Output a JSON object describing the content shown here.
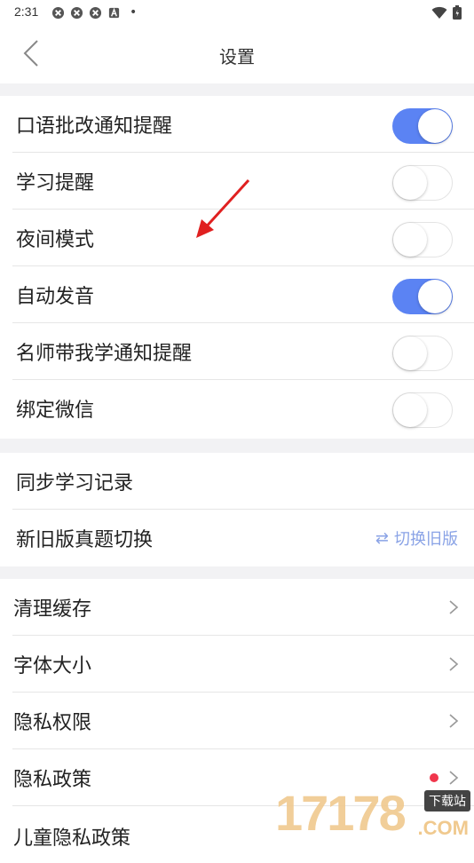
{
  "status_bar": {
    "time": "2:31",
    "dot": "•",
    "icons": [
      "app-icon",
      "app-icon",
      "app-icon",
      "a-icon"
    ],
    "right_icons": [
      "wifi-icon",
      "battery-icon"
    ]
  },
  "header": {
    "title": "设置"
  },
  "toggles": [
    {
      "label": "口语批改通知提醒",
      "on": true
    },
    {
      "label": "学习提醒",
      "on": false
    },
    {
      "label": "夜间模式",
      "on": false
    },
    {
      "label": "自动发音",
      "on": true
    },
    {
      "label": "名师带我学通知提醒",
      "on": false
    },
    {
      "label": "绑定微信",
      "on": false
    }
  ],
  "sync": {
    "label": "同步学习记录"
  },
  "version_switch": {
    "label": "新旧版真题切换",
    "action_icon": "⇄",
    "action_label": "切换旧版"
  },
  "links": [
    {
      "label": "清理缓存",
      "dot": false
    },
    {
      "label": "字体大小",
      "dot": false
    },
    {
      "label": "隐私权限",
      "dot": false
    },
    {
      "label": "隐私政策",
      "dot": true
    },
    {
      "label": "儿童隐私政策",
      "dot": false
    }
  ],
  "watermark": {
    "digits": "17178",
    "tag": "下载站",
    "suffix": ".COM"
  },
  "colors": {
    "toggle_on": "#5b83f3",
    "section_gap": "#f2f2f4",
    "link_blue": "#8aa3e6",
    "red_dot": "#f0364c",
    "annotation_arrow": "#e02020"
  }
}
